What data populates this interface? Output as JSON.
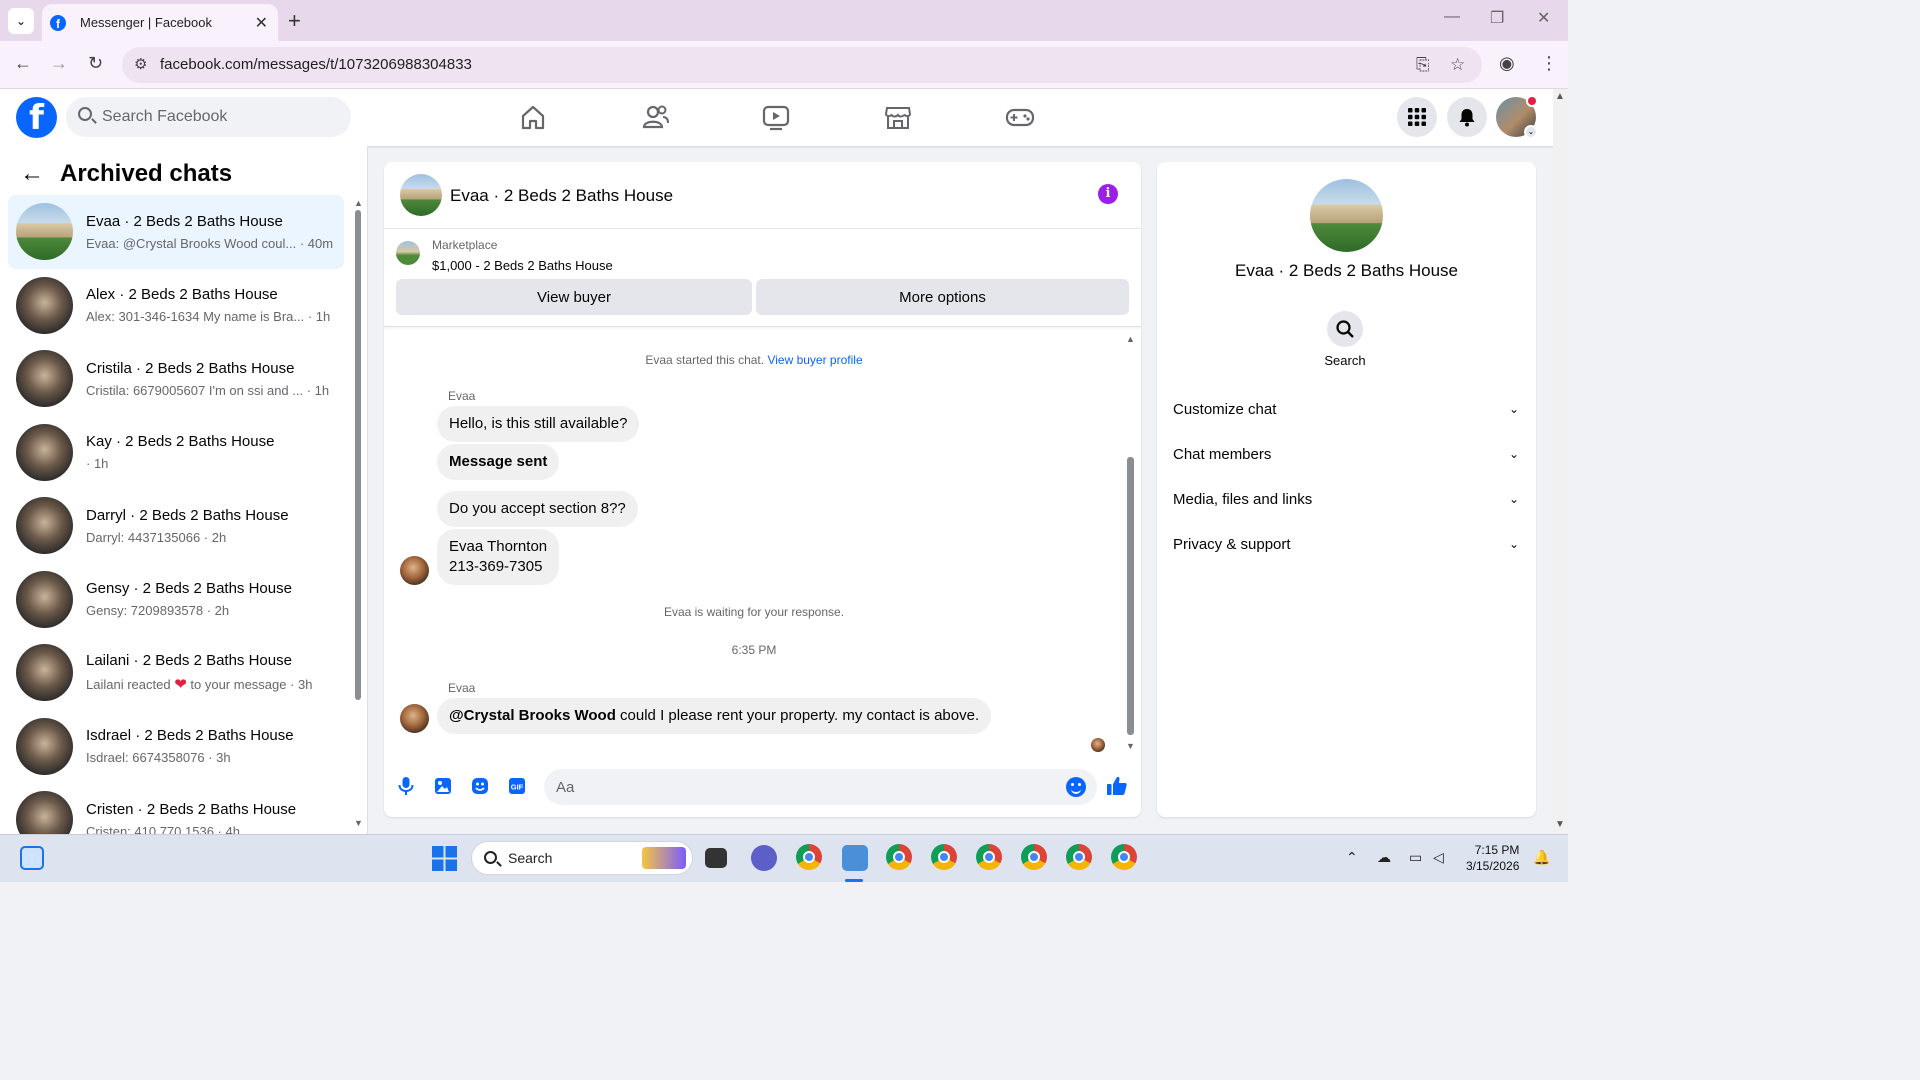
{
  "browser": {
    "tab_title": "Messenger | Facebook",
    "tab_close": "✕",
    "new_tab": "+",
    "url": "facebook.com/messages/t/1073206988304833"
  },
  "fb": {
    "search_placeholder": "Search Facebook",
    "logo": "f"
  },
  "left": {
    "title": "Archived chats",
    "chats": [
      {
        "name": "Evaa · 2 Beds 2 Baths House",
        "preview": "Evaa: @Crystal Brooks Wood coul... · 40m",
        "active": true
      },
      {
        "name": "Alex · 2 Beds 2 Baths House",
        "preview": "Alex: 301-346-1634 My name is Bra... · 1h"
      },
      {
        "name": "Cristila · 2 Beds 2 Baths House",
        "preview": "Cristila: 6679005607 I'm on ssi and ... · 1h"
      },
      {
        "name": "Kay · 2 Beds 2 Baths House",
        "preview": "· 1h"
      },
      {
        "name": "Darryl · 2 Beds 2 Baths House",
        "preview": "Darryl: 4437135066 · 2h"
      },
      {
        "name": "Gensy · 2 Beds 2 Baths House",
        "preview": "Gensy: 7209893578 · 2h"
      },
      {
        "name": "Lailani · 2 Beds 2 Baths House",
        "preview_a": "Lailani reacted",
        "preview_b": "to your message · 3h"
      },
      {
        "name": "Isdrael · 2 Beds 2 Baths House",
        "preview": "Isdrael: 6674358076 · 3h"
      },
      {
        "name": "Cristen · 2 Beds 2 Baths House",
        "preview": "Cristen: 410 770 1536 · 4h"
      }
    ]
  },
  "conversation": {
    "title": "Evaa · 2 Beds 2 Baths House",
    "info_icon": "i",
    "marketplace_label": "Marketplace",
    "listing": "$1,000 - 2 Beds 2 Baths House",
    "view_buyer": "View buyer",
    "more_options": "More options",
    "started_note": "Evaa started this chat.",
    "view_buyer_profile": "View buyer profile",
    "sender1": "Evaa",
    "msg1": "Hello, is this still available?",
    "msg2": "Message sent",
    "msg3": "Do you accept section 8??",
    "msg4_line1": "Evaa Thornton",
    "msg4_line2": "213-369-7305",
    "waiting_note": "Evaa is waiting for your response.",
    "timestamp": "6:35 PM",
    "sender2": "Evaa",
    "msg5_mention": "@Crystal Brooks Wood",
    "msg5_text": " could I please rent your property.  my contact is above.",
    "composer_placeholder": "Aa"
  },
  "details": {
    "name": "Evaa · 2 Beds 2 Baths House",
    "search_label": "Search",
    "sections": [
      "Customize chat",
      "Chat members",
      "Media, files and links",
      "Privacy & support"
    ]
  },
  "taskbar": {
    "search": "Search",
    "time": "7:15 PM",
    "date": "3/15/2026"
  },
  "colors": {
    "fb_blue": "#0866ff",
    "info_purple": "#9b1fe8",
    "active_row": "#ebf5ff"
  }
}
